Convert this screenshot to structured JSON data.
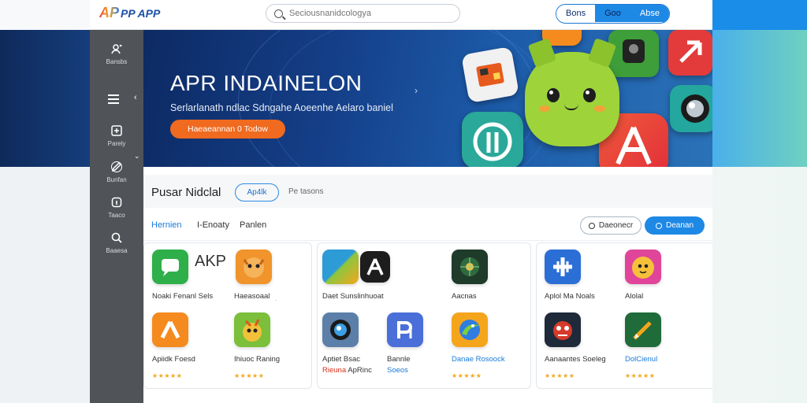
{
  "header": {
    "logo_mark": "AP",
    "logo_text": "PP APP",
    "search_placeholder": "Seciousnanidcologya",
    "actions": [
      "Bons",
      "Goo",
      "Abse"
    ]
  },
  "sidebar": {
    "items": [
      {
        "label": "Bansbs",
        "icon": "shield-user-icon"
      },
      {
        "label": "Parely",
        "icon": "puzzle-icon"
      },
      {
        "label": "Bunfan",
        "icon": "edit-icon"
      },
      {
        "label": "Taaco",
        "icon": "info-icon"
      },
      {
        "label": "Baaesa",
        "icon": "search-icon"
      }
    ]
  },
  "hero": {
    "title": "APR INDAINELON",
    "subtitle": "Serlarlanath ndlac Sdngahe Aoeenhe Aelaro baniel",
    "cta": "Haeaeannan 0 Todow"
  },
  "section": {
    "title": "Pusar Nidclal",
    "pill": "Ap4lk",
    "other": "Pe tasons"
  },
  "filters": {
    "tabs": [
      "Hernien",
      "I-Enoaty",
      "Panlen"
    ],
    "outline_button": "Daeonecr",
    "primary_button": "Deanan"
  },
  "apps": {
    "p1a": {
      "name": "Noaki Fenanl Sels"
    },
    "p1b": {
      "name": "Haeasoaal"
    },
    "p1c": {
      "name": "Apiidk Foesd"
    },
    "p1d": {
      "name": "Ihiuoc Raning"
    },
    "p2a": {
      "name": "Daet Sunslinhuoat"
    },
    "p2b": {
      "name": "Aacnas"
    },
    "p2c": {
      "name": "Aptiet Bsac",
      "sub_red": "Rieuna",
      "sub_rest": "ApRinc"
    },
    "p2d": {
      "name": "Bannle",
      "sub_blue": "Soeos"
    },
    "p2e": {
      "name": "Danae Rosoock"
    },
    "p3a": {
      "name": "Aplol Ma Noals"
    },
    "p3b": {
      "name": "Alolal"
    },
    "p3c": {
      "name": "Aanaantes Soeleg"
    },
    "p3d": {
      "name": "DolCienul"
    }
  },
  "stars": "★★★★★",
  "colors": {
    "accent": "#1e88e5",
    "cta": "#f06a1f",
    "sidebar": "#505459"
  }
}
